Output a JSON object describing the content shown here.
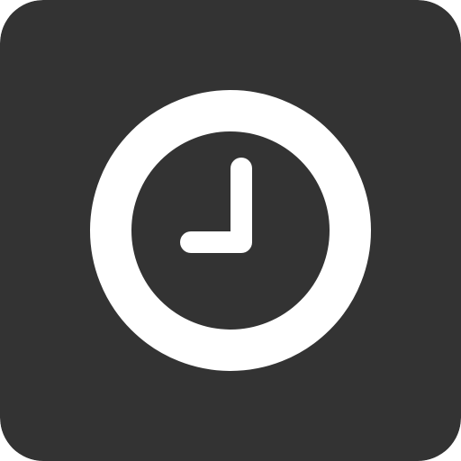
{
  "icon": {
    "name": "clock-icon",
    "colors": {
      "tile": "#333333",
      "glyph": "#ffffff"
    }
  }
}
